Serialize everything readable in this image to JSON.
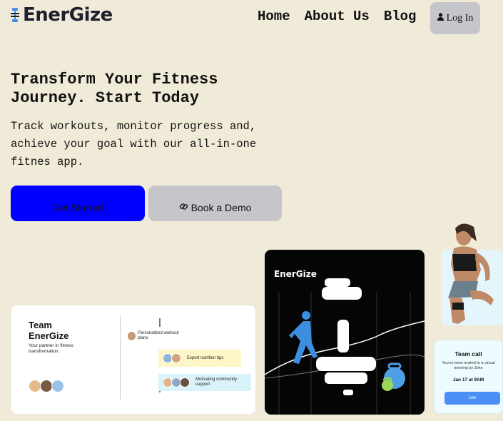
{
  "header": {
    "logo_text": "EnerGize",
    "logo_icon": "dumbbell-icon",
    "nav": [
      "Home",
      "About Us",
      "Blog"
    ],
    "login_label": "Log In",
    "login_icon": "user-icon"
  },
  "hero": {
    "title_line1": "Transform Your Fitness",
    "title_line2": "Journey. Start Today",
    "sub_line1": "Track workouts, monitor progress and,",
    "sub_line2": "achieve your goal with our all-in-one",
    "sub_line3": "fitnes app.",
    "primary_label": "Get Started",
    "secondary_label": "Book a Demo",
    "secondary_icon": "link-icon"
  },
  "team_card": {
    "title_line1": "Team",
    "title_line2": "EnerGize",
    "subtitle": "Your partner in fitness transformation.",
    "features": [
      "Personalized workout plans",
      "Expert nutrition tips",
      "Motivating community support"
    ]
  },
  "dark_card": {
    "brand": "EnerGize"
  },
  "call_card": {
    "title": "Team call",
    "invite": "You've been invited to a virtual meeting by John",
    "date": "Jan 17 at 9AM",
    "join_label": "Join"
  },
  "colors": {
    "background": "#f0ead8",
    "primary_button": "#0000ff",
    "secondary_button": "#c6c5ca",
    "logo_accent": "#4a90e2"
  }
}
